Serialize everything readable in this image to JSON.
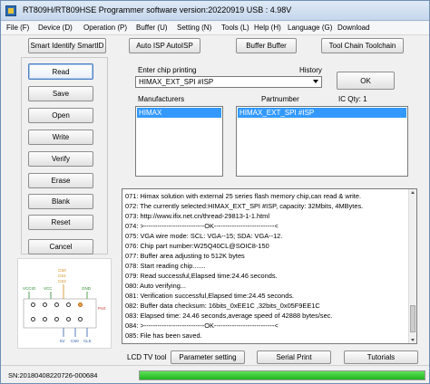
{
  "window": {
    "title": "RT809H/RT809HSE Programmer software version:20220919  USB : 4.98V"
  },
  "menu": [
    "File (F)",
    "Device (D)",
    "Operation (P)",
    "Buffer (U)",
    "Setting (N)",
    "Tools (L)",
    "Help (H)",
    "Language (G)",
    "Download"
  ],
  "toolbar": {
    "smart_identify": "Smart Identify SmartID",
    "auto_isp": "Auto ISP AutoISP",
    "buffer": "Buffer Buffer",
    "tool_chain": "Tool Chain Toolchain"
  },
  "actions": [
    "Read",
    "Save",
    "Open",
    "Write",
    "Verify",
    "Erase",
    "Blank",
    "Reset"
  ],
  "cancel_label": "Cancel",
  "chip": {
    "enter_label": "Enter chip printing",
    "history_label": "History",
    "value": "HIMAX_EXT_SPI #ISP",
    "ok_label": "OK",
    "manufacturers_label": "Manufacturers",
    "partnumber_label": "Partnumber",
    "ic_qty_label": "IC Qty: 1",
    "manufacturer_selected": "HIMAX",
    "partnumber_selected": "HIMAX_EXT_SPI #ISP"
  },
  "log": [
    "071:  Himax solution with external 25 series flash memory chip,can read & write.",
    "072:  The currently selected:HIMAX_EXT_SPI #ISP, capacity: 32Mbits, 4MBytes.",
    "073:  http://www.ifix.net.cn/thread-29813-1-1.html",
    "074:  >---------------------------OK---------------------------<",
    "075:  VGA wire mode: SCL: VGA--15; SDA: VGA--12.",
    "076:  Chip part number:W25Q40CL@SOIC8-150",
    "077:  Buffer area adjusting to 512K bytes",
    "078:  Start reading chip.......",
    "079:  Read successful,Elapsed time:24.46 seconds.",
    "080:  Auto verifying...",
    "081:  Verification successful,Elapsed time:24.45 seconds.",
    "082:  Buffer data checksum: 16bits_0xEE1C ,32bits_0x05F9EE1C",
    "083:  Elapsed time: 24.46 seconds,average speed of 42888 bytes/sec.",
    "084:  >---------------------------OK---------------------------<",
    "085:  File has been saved."
  ],
  "bottom_tabs": {
    "lcd_tv_tool": "LCD TV tool",
    "parameter_setting": "Parameter setting",
    "serial_print": "Serial Print",
    "tutorials": "Tutorials"
  },
  "diagram": {
    "top_labels": [
      "CS0",
      "CS1",
      "CS2"
    ],
    "left_labels": [
      "VCCIO",
      "VCC",
      "GND"
    ],
    "right_label": "Port",
    "bottom_labels": [
      "5V",
      "CS0",
      "CLK"
    ]
  },
  "status": {
    "sn": "SN:20180408220726-000684",
    "progress": 1.0,
    "progress_color": "#2fbf2a"
  },
  "colors": {
    "selection": "#3399ff",
    "accent": "#4f7fc1"
  }
}
